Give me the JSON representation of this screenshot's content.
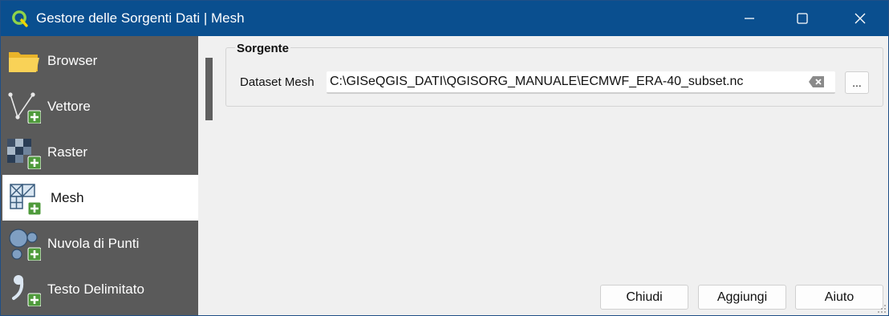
{
  "window": {
    "title": "Gestore delle Sorgenti Dati | Mesh",
    "title_bar_color": "#0a4f8f"
  },
  "titlebar_controls": [
    {
      "name": "minimize-icon"
    },
    {
      "name": "maximize-icon"
    },
    {
      "name": "close-icon"
    }
  ],
  "sidebar": {
    "background_color": "#5a5a5a",
    "items": [
      {
        "label": "Browser",
        "icon": "folder-icon",
        "selected": false
      },
      {
        "label": "Vettore",
        "icon": "add-vector-icon",
        "selected": false
      },
      {
        "label": "Raster",
        "icon": "add-raster-icon",
        "selected": false
      },
      {
        "label": "Mesh",
        "icon": "add-mesh-icon",
        "selected": true
      },
      {
        "label": "Nuvola di Punti",
        "icon": "add-point-cloud-icon",
        "selected": false
      },
      {
        "label": "Testo Delimitato",
        "icon": "add-delimited-text-icon",
        "selected": false
      }
    ]
  },
  "source": {
    "group_title": "Sorgente",
    "dataset_label": "Dataset Mesh",
    "dataset_value": "C:\\GISeQGIS_DATI\\QGISORG_MANUALE\\ECMWF_ERA-40_subset.nc",
    "browse_label": "..."
  },
  "footer": {
    "close_label": "Chiudi",
    "add_label": "Aggiungi",
    "help_label": "Aiuto"
  }
}
